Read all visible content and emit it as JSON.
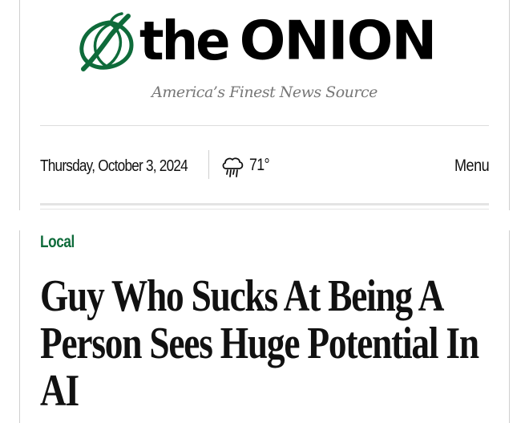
{
  "brand": {
    "logo_word_the": "the",
    "logo_word_onion": "ONION",
    "tagline": "America’s Finest News Source",
    "logo_color": "#000000",
    "icon_color": "#0e6b3a"
  },
  "header": {
    "date": "Thursday, October 3, 2024",
    "weather": {
      "icon": "rain-cloud-icon",
      "temperature": "71°"
    },
    "menu_label": "Menu"
  },
  "article": {
    "section": "Local",
    "section_color": "#0e6b3a",
    "headline": "Guy Who Sucks At Being A Person Sees Huge Potential In AI"
  }
}
